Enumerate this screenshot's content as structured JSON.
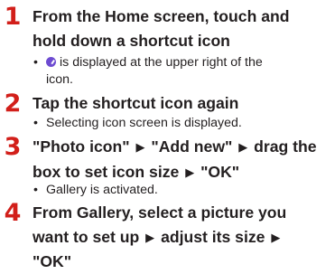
{
  "steps": [
    {
      "number": "1",
      "lines": [
        "From the Home screen, touch and",
        "hold down a shortcut icon"
      ],
      "note": {
        "bullet": "•",
        "icon": "purple-badge-icon",
        "line1": "is displayed at the upper right of the",
        "line2": "icon."
      }
    },
    {
      "number": "2",
      "lines": [
        "Tap the shortcut icon again"
      ],
      "note": {
        "bullet": "•",
        "line1": "Selecting icon screen is displayed."
      }
    },
    {
      "number": "3",
      "line1_parts": [
        "\"Photo icon\"",
        "\"Add new\"",
        "drag the"
      ],
      "line2_parts": [
        "box to set icon size",
        "\"OK\""
      ],
      "arrow": "▶",
      "note": {
        "bullet": "•",
        "line1": "Gallery is activated."
      }
    },
    {
      "number": "4",
      "lines": [
        "From Gallery, select a picture you"
      ],
      "line2_parts": [
        "want to set up",
        "adjust its size"
      ],
      "line3": "\"OK\"",
      "arrow": "▶"
    }
  ],
  "colors": {
    "step_number": "#d21f1a",
    "text": "#231f20",
    "badge": "#6d4bd1"
  }
}
